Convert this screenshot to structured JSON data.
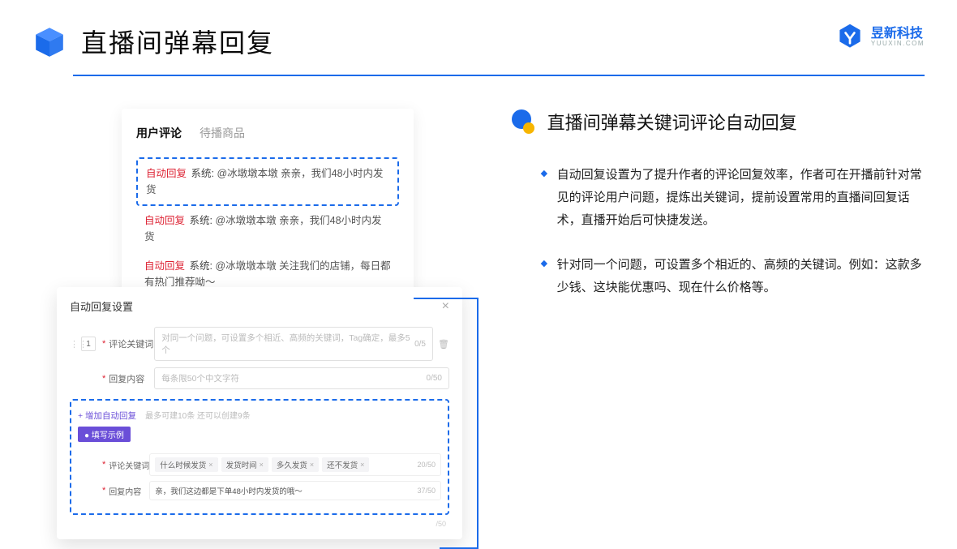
{
  "header": {
    "title": "直播间弹幕回复"
  },
  "brand": {
    "cn": "昱新科技",
    "en": "YUUXIN.COM"
  },
  "tabs": {
    "active": "用户评论",
    "inactive": "待播商品"
  },
  "comments": [
    {
      "tag": "自动回复",
      "sys": "系统:",
      "text": "@冰墩墩本墩 亲亲，我们48小时内发货"
    },
    {
      "tag": "自动回复",
      "sys": "系统:",
      "text": "@冰墩墩本墩 亲亲，我们48小时内发货"
    },
    {
      "tag": "自动回复",
      "sys": "系统:",
      "text": "@冰墩墩本墩 关注我们的店铺，每日都有热门推荐呦～"
    }
  ],
  "settings": {
    "title": "自动回复设置",
    "row1_num": "1",
    "kw_label": "评论关键词",
    "kw_placeholder": "对同一个问题，可设置多个相近、高频的关键词，Tag确定，最多5个",
    "kw_count": "0/5",
    "reply_label": "回复内容",
    "reply_placeholder": "每条限50个中文字符",
    "reply_count": "0/50",
    "add_link": "+ 增加自动回复",
    "add_hint": "最多可建10条 还可以创建9条",
    "ex_badge": "● 填写示例",
    "ex_kw_label": "评论关键词",
    "ex_chips": [
      "什么时候发货",
      "发货时间",
      "多久发货",
      "还不发货"
    ],
    "ex_kw_count": "20/50",
    "ex_reply_label": "回复内容",
    "ex_reply_text": "亲，我们这边都是下单48小时内发货的哦～",
    "ex_reply_count": "37/50",
    "ghost": "/50"
  },
  "right": {
    "title": "直播间弹幕关键词评论自动回复",
    "bullets": [
      "自动回复设置为了提升作者的评论回复效率，作者可在开播前针对常见的评论用户问题，提炼出关键词，提前设置常用的直播间回复话术，直播开始后可快捷发送。",
      "针对同一个问题，可设置多个相近的、高频的关键词。例如：这款多少钱、这块能优惠吗、现在什么价格等。"
    ]
  }
}
